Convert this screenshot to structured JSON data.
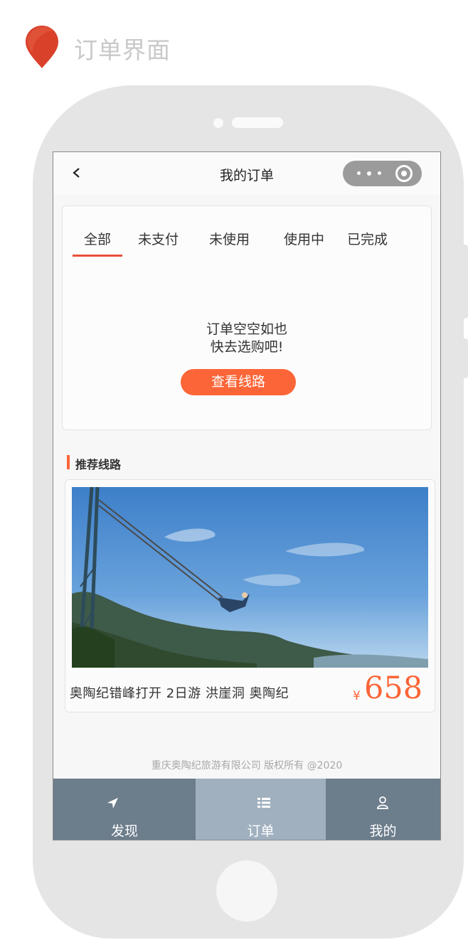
{
  "page": {
    "title": "订单界面"
  },
  "nav": {
    "title": "我的订单"
  },
  "tabs": [
    "全部",
    "未支付",
    "未使用",
    "使用中",
    "已完成"
  ],
  "empty": {
    "line1": "订单空空如也",
    "line2": "快去选购吧!",
    "button": "查看线路"
  },
  "recommend": {
    "title": "推荐线路",
    "route": {
      "name": "奥陶纪错峰打开  2日游  洪崖洞  奥陶纪",
      "currency": "¥",
      "price": "658"
    }
  },
  "footer": {
    "copyright": "重庆奥陶纪旅游有限公司  版权所有    @2020"
  },
  "tabbar": {
    "discover": "发现",
    "orders": "订单",
    "mine": "我的"
  },
  "colors": {
    "accent": "#fb6537",
    "tab_underline": "#e9503b",
    "tabbar": "#6c7d8c",
    "tabbar_active": "#a0b0bf"
  },
  "icons": [
    "location-pin-icon",
    "back-arrow-icon",
    "more-dots-icon",
    "close-target-icon",
    "navigation-arrow-icon",
    "list-icon",
    "user-icon"
  ]
}
